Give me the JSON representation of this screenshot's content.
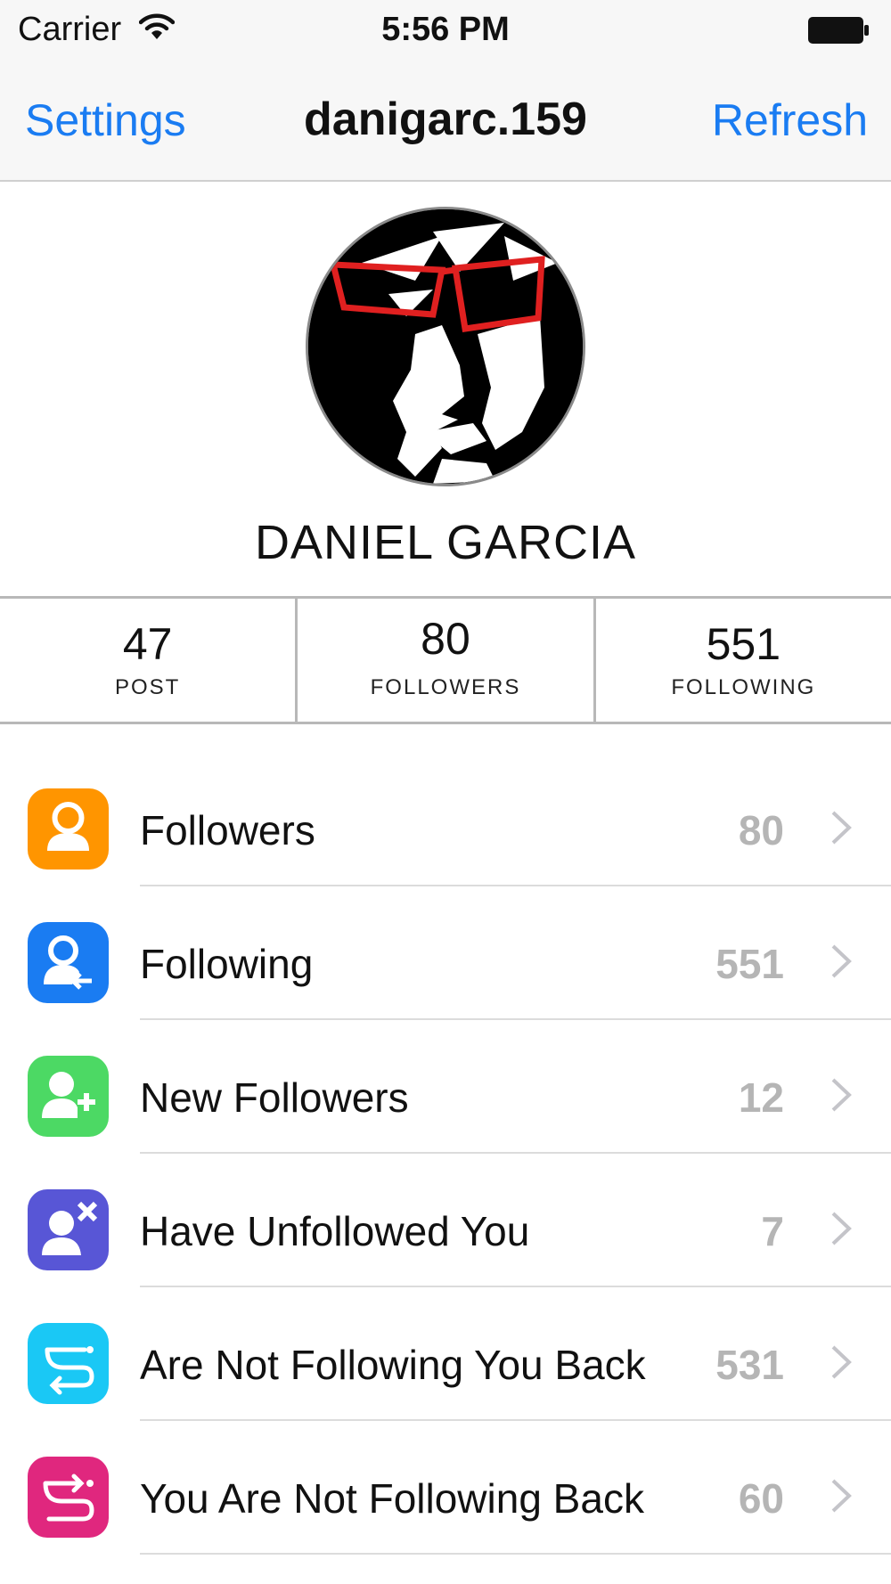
{
  "status_bar": {
    "carrier": "Carrier",
    "time": "5:56 PM"
  },
  "nav": {
    "left_label": "Settings",
    "title": "danigarc.159",
    "right_label": "Refresh"
  },
  "profile": {
    "name": "DANIEL GARCIA"
  },
  "stats": [
    {
      "value": "47",
      "label": "POST"
    },
    {
      "value": "80",
      "label": "FOLLOWERS"
    },
    {
      "value": "551",
      "label": "FOLLOWING"
    }
  ],
  "menu": [
    {
      "label": "Followers",
      "count": "80",
      "icon": "person-icon",
      "color": "#ff9500"
    },
    {
      "label": "Following",
      "count": "551",
      "icon": "person-arrow-icon",
      "color": "#1a7cf2"
    },
    {
      "label": "New Followers",
      "count": "12",
      "icon": "person-plus-icon",
      "color": "#4cd964"
    },
    {
      "label": "Have Unfollowed You",
      "count": "7",
      "icon": "person-x-icon",
      "color": "#5856d6"
    },
    {
      "label": "Are Not Following You Back",
      "count": "531",
      "icon": "swap-arrows-icon",
      "color": "#1ac8f5"
    },
    {
      "label": "You Are Not Following Back",
      "count": "60",
      "icon": "swap-arrows-icon",
      "color": "#e0277e"
    }
  ]
}
